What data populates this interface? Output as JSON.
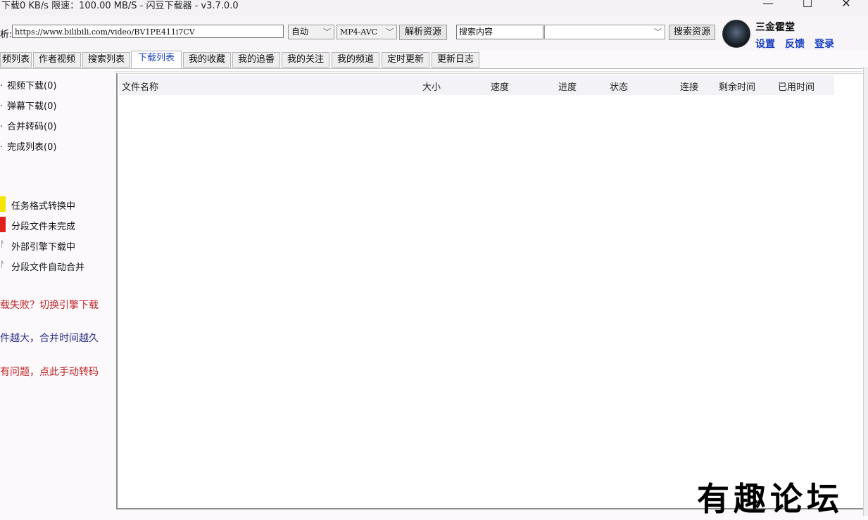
{
  "titlebar": {
    "title": "下载0 KB/s  限速：100.00 MB/S  - 闪豆下载器 - v3.7.0.0",
    "minimize": "—",
    "maximize": "☐",
    "close": "✕"
  },
  "toolbar": {
    "url_label": "析:",
    "url_value": "https://www.bilibili.com/video/BV1PE411i7CV",
    "quality_select": "自动",
    "format_select": "MP4-AVC",
    "parse_button": "解析资源",
    "search_value": "搜索内容",
    "search_type_select": "",
    "search_button": "搜索资源"
  },
  "user": {
    "name": "三金霍堂",
    "settings": "设置",
    "feedback": "反馈",
    "login": "登录"
  },
  "tabs": [
    {
      "label": "频列表"
    },
    {
      "label": "作者视频"
    },
    {
      "label": "搜索列表"
    },
    {
      "label": "下载列表"
    },
    {
      "label": "我的收藏"
    },
    {
      "label": "我的追番"
    },
    {
      "label": "我的关注"
    },
    {
      "label": "我的频道"
    },
    {
      "label": "定时更新"
    },
    {
      "label": "更新日志"
    }
  ],
  "sidebar": {
    "categories": [
      {
        "label": "视频下载(0)"
      },
      {
        "label": "弹幕下载(0)"
      },
      {
        "label": "合并转码(0)"
      },
      {
        "label": "完成列表(0)"
      }
    ],
    "legend": [
      {
        "label": "任务格式转换中",
        "color": "#f5e600"
      },
      {
        "label": "分段文件未完成",
        "color": "#e0201a"
      },
      {
        "label": "外部引擎下载中",
        "symbol": "ᚨ"
      },
      {
        "label": "分段文件自动合并",
        "symbol": "ᚨ"
      }
    ],
    "hints": [
      {
        "label": "载失败？切换引擎下载",
        "color": "#c02424"
      },
      {
        "label": "件越大，合并时间越久",
        "color": "#2a2f85"
      },
      {
        "label": "有问题，点此手动转码",
        "color": "#c02424"
      }
    ]
  },
  "download_list": {
    "columns": [
      "文件名称",
      "大小",
      "速度",
      "进度",
      "状态",
      "连接",
      "剩余时间",
      "已用时间"
    ],
    "rows": []
  },
  "watermark": "有趣论坛"
}
